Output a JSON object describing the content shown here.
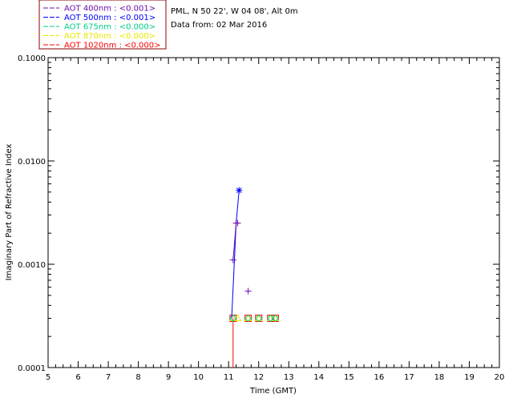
{
  "header": {
    "site": "PML, N 50 22', W 04 08', Alt 0m",
    "date": "Data from: 02 Mar 2016"
  },
  "chart_data": {
    "type": "line",
    "xlabel": "Time (GMT)",
    "ylabel": "Imaginary Part of Refractive Index",
    "xlim": [
      5,
      20
    ],
    "ylim": [
      0.0001,
      0.1
    ],
    "yscale": "log",
    "x_ticks": [
      "5",
      "6",
      "7",
      "8",
      "9",
      "10",
      "11",
      "12",
      "13",
      "14",
      "15",
      "16",
      "17",
      "18",
      "19",
      "20"
    ],
    "y_ticks": [
      "0.0001",
      "0.0010",
      "0.0100",
      "0.1000"
    ],
    "grid": false,
    "legend": {
      "placement": "top-left-outside"
    },
    "series": [
      {
        "name": "AOT  400nm : <0.001>",
        "color": "#6a0dad",
        "marker": "plus",
        "points": [
          [
            11.15,
            0.0011
          ],
          [
            11.25,
            0.0025
          ],
          [
            11.3,
            0.0025
          ],
          [
            11.65,
            0.00055
          ]
        ],
        "line": [
          [
            11.15,
            0.0011
          ],
          [
            11.25,
            0.0025
          ]
        ]
      },
      {
        "name": "AOT  500nm : <0.001>",
        "color": "#0000ff",
        "marker": "asterisk",
        "points": [
          [
            11.35,
            0.0052
          ]
        ],
        "line": [
          [
            11.1,
            0.0003
          ],
          [
            11.2,
            0.0012
          ],
          [
            11.25,
            0.0025
          ],
          [
            11.35,
            0.0052
          ]
        ]
      },
      {
        "name": "AOT  675nm : <0.000>",
        "color": "#00cc88",
        "marker": "diamond",
        "points": [
          [
            11.15,
            0.0003
          ],
          [
            11.65,
            0.0003
          ],
          [
            12.0,
            0.0003
          ],
          [
            12.4,
            0.0003
          ],
          [
            12.55,
            0.0003
          ]
        ],
        "line": []
      },
      {
        "name": "AOT  870nm : <0.000>",
        "color": "#e8e800",
        "marker": "triangle",
        "points": [
          [
            11.15,
            0.0003
          ],
          [
            11.3,
            0.0003
          ],
          [
            11.65,
            0.0003
          ],
          [
            12.0,
            0.0003
          ],
          [
            12.4,
            0.0003
          ],
          [
            12.55,
            0.0003
          ]
        ],
        "line": []
      },
      {
        "name": "AOT 1020nm : <0.000>",
        "color": "#ff0000",
        "marker": "square",
        "points": [
          [
            11.15,
            0.0003
          ],
          [
            11.65,
            0.0003
          ],
          [
            12.0,
            0.0003
          ],
          [
            12.4,
            0.0003
          ],
          [
            12.55,
            0.0003
          ]
        ],
        "line": [
          [
            11.15,
            0.0001
          ],
          [
            11.15,
            0.0003
          ]
        ]
      }
    ]
  }
}
